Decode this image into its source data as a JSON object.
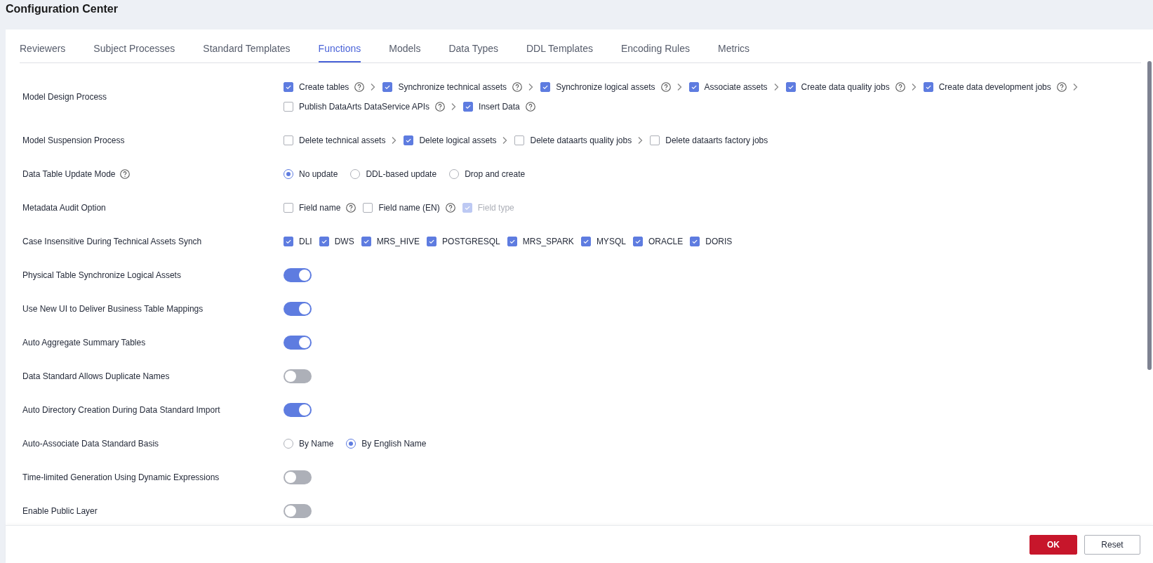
{
  "page_title": "Configuration Center",
  "tabs": [
    {
      "label": "Reviewers",
      "selected": false
    },
    {
      "label": "Subject Processes",
      "selected": false
    },
    {
      "label": "Standard Templates",
      "selected": false
    },
    {
      "label": "Functions",
      "selected": true
    },
    {
      "label": "Models",
      "selected": false
    },
    {
      "label": "Data Types",
      "selected": false
    },
    {
      "label": "DDL Templates",
      "selected": false
    },
    {
      "label": "Encoding Rules",
      "selected": false
    },
    {
      "label": "Metrics",
      "selected": false
    }
  ],
  "settings": [
    {
      "label": "Model Design Process",
      "help": false,
      "kind": "checks",
      "items": [
        {
          "label": "Create tables",
          "checked": true,
          "disabled": false,
          "help": true,
          "arrow": true
        },
        {
          "label": "Synchronize technical assets",
          "checked": true,
          "disabled": false,
          "help": true,
          "arrow": true
        },
        {
          "label": "Synchronize logical assets",
          "checked": true,
          "disabled": false,
          "help": true,
          "arrow": true
        },
        {
          "label": "Associate assets",
          "checked": true,
          "disabled": false,
          "help": false,
          "arrow": true
        },
        {
          "label": "Create data quality jobs",
          "checked": true,
          "disabled": false,
          "help": true,
          "arrow": true
        },
        {
          "label": "Create data development jobs",
          "checked": true,
          "disabled": false,
          "help": true,
          "arrow": true
        },
        {
          "label": "Publish DataArts DataService APIs",
          "checked": false,
          "disabled": false,
          "help": true,
          "arrow": true
        },
        {
          "label": "Insert Data",
          "checked": true,
          "disabled": false,
          "help": true,
          "arrow": false
        }
      ]
    },
    {
      "label": "Model Suspension Process",
      "help": false,
      "kind": "checks",
      "items": [
        {
          "label": "Delete technical assets",
          "checked": false,
          "disabled": false,
          "help": false,
          "arrow": true
        },
        {
          "label": "Delete logical assets",
          "checked": true,
          "disabled": false,
          "help": false,
          "arrow": true
        },
        {
          "label": "Delete dataarts quality jobs",
          "checked": false,
          "disabled": false,
          "help": false,
          "arrow": true
        },
        {
          "label": "Delete dataarts factory jobs",
          "checked": false,
          "disabled": false,
          "help": false,
          "arrow": false
        }
      ]
    },
    {
      "label": "Data Table Update Mode",
      "help": true,
      "kind": "radios",
      "items": [
        {
          "label": "No update",
          "selected": true
        },
        {
          "label": "DDL-based update",
          "selected": false
        },
        {
          "label": "Drop and create",
          "selected": false
        }
      ]
    },
    {
      "label": "Metadata Audit Option",
      "help": false,
      "kind": "checks",
      "items": [
        {
          "label": "Field name",
          "checked": false,
          "disabled": false,
          "help": true,
          "arrow": false
        },
        {
          "label": "Field name (EN)",
          "checked": false,
          "disabled": false,
          "help": true,
          "arrow": false
        },
        {
          "label": "Field type",
          "checked": true,
          "disabled": true,
          "help": false,
          "arrow": false
        }
      ]
    },
    {
      "label": "Case Insensitive During Technical Assets Synch",
      "help": false,
      "kind": "checks",
      "items": [
        {
          "label": "DLI",
          "checked": true,
          "disabled": false,
          "help": false,
          "arrow": false
        },
        {
          "label": "DWS",
          "checked": true,
          "disabled": false,
          "help": false,
          "arrow": false
        },
        {
          "label": "MRS_HIVE",
          "checked": true,
          "disabled": false,
          "help": false,
          "arrow": false
        },
        {
          "label": "POSTGRESQL",
          "checked": true,
          "disabled": false,
          "help": false,
          "arrow": false
        },
        {
          "label": "MRS_SPARK",
          "checked": true,
          "disabled": false,
          "help": false,
          "arrow": false
        },
        {
          "label": "MYSQL",
          "checked": true,
          "disabled": false,
          "help": false,
          "arrow": false
        },
        {
          "label": "ORACLE",
          "checked": true,
          "disabled": false,
          "help": false,
          "arrow": false
        },
        {
          "label": "DORIS",
          "checked": true,
          "disabled": false,
          "help": false,
          "arrow": false
        }
      ]
    },
    {
      "label": "Physical Table Synchronize Logical Assets",
      "help": false,
      "kind": "switch",
      "on": true
    },
    {
      "label": "Use New UI to Deliver Business Table Mappings",
      "help": false,
      "kind": "switch",
      "on": true
    },
    {
      "label": "Auto Aggregate Summary Tables",
      "help": false,
      "kind": "switch",
      "on": true
    },
    {
      "label": "Data Standard Allows Duplicate Names",
      "help": false,
      "kind": "switch",
      "on": false
    },
    {
      "label": "Auto Directory Creation During Data Standard Import",
      "help": false,
      "kind": "switch",
      "on": true
    },
    {
      "label": "Auto-Associate Data Standard Basis",
      "help": false,
      "kind": "radios",
      "items": [
        {
          "label": "By Name",
          "selected": false
        },
        {
          "label": "By English Name",
          "selected": true
        }
      ]
    },
    {
      "label": "Time-limited Generation Using Dynamic Expressions",
      "help": false,
      "kind": "switch",
      "on": false
    },
    {
      "label": "Enable Public Layer",
      "help": false,
      "kind": "switch",
      "on": false
    }
  ],
  "buttons": {
    "ok": "OK",
    "reset": "Reset"
  }
}
